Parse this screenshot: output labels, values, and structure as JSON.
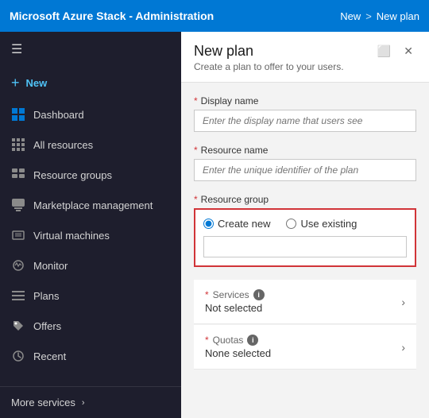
{
  "topBar": {
    "title": "Microsoft Azure Stack - Administration",
    "breadcrumb": [
      "New",
      ">",
      "New plan"
    ]
  },
  "sidebar": {
    "hamburger": "☰",
    "newLabel": "New",
    "items": [
      {
        "id": "dashboard",
        "label": "Dashboard",
        "icon": "dashboard"
      },
      {
        "id": "all-resources",
        "label": "All resources",
        "icon": "grid"
      },
      {
        "id": "resource-groups",
        "label": "Resource groups",
        "icon": "grid"
      },
      {
        "id": "marketplace-management",
        "label": "Marketplace management",
        "icon": "grid"
      },
      {
        "id": "virtual-machines",
        "label": "Virtual machines",
        "icon": "vm"
      },
      {
        "id": "monitor",
        "label": "Monitor",
        "icon": "circle"
      },
      {
        "id": "plans",
        "label": "Plans",
        "icon": "lines"
      },
      {
        "id": "offers",
        "label": "Offers",
        "icon": "tag"
      },
      {
        "id": "recent",
        "label": "Recent",
        "icon": "clock"
      }
    ],
    "moreServices": "More services"
  },
  "panel": {
    "title": "New plan",
    "subtitle": "Create a plan to offer to your users.",
    "windowBtn": "⬜",
    "closeBtn": "✕",
    "form": {
      "displayNameLabel": "Display name",
      "displayNamePlaceholder": "Enter the display name that users see",
      "resourceNameLabel": "Resource name",
      "resourceNamePlaceholder": "Enter the unique identifier of the plan",
      "resourceGroupLabel": "Resource group",
      "createNewLabel": "Create new",
      "useExistingLabel": "Use existing",
      "servicesLabel": "Services",
      "servicesInfoTitle": "Services info",
      "servicesValue": "Not selected",
      "quotasLabel": "Quotas",
      "quotasInfoTitle": "Quotas info",
      "quotasValue": "None selected"
    }
  }
}
